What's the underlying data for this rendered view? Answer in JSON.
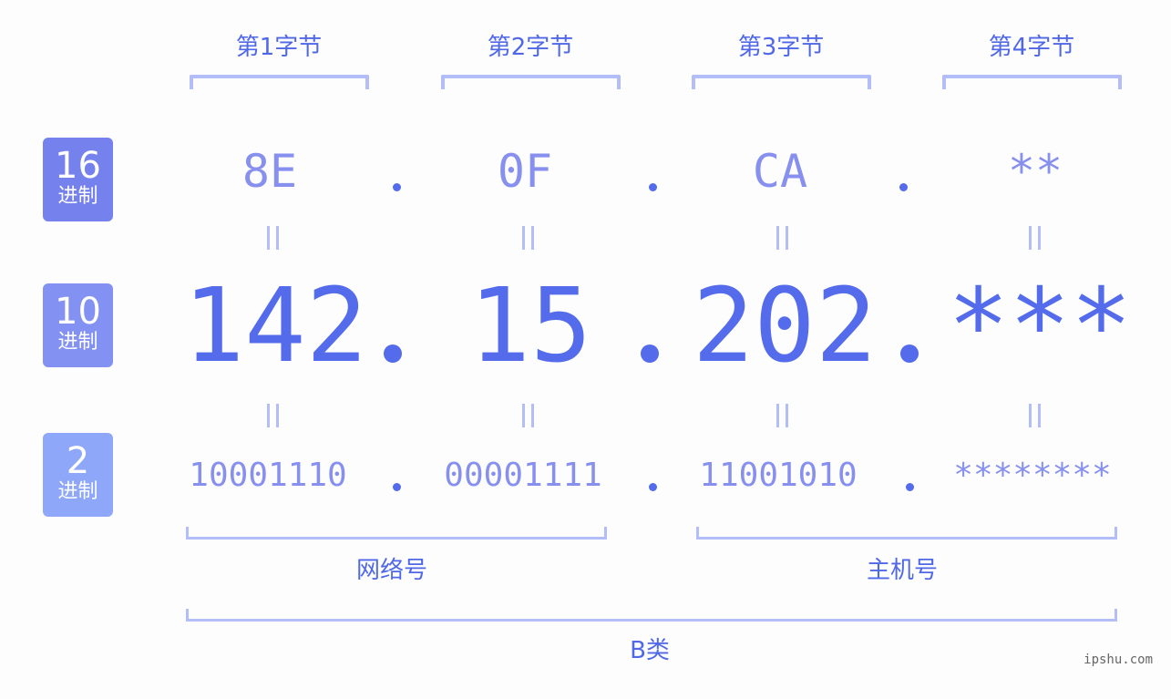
{
  "colors": {
    "accent": "#546cec",
    "label_text": "#5068e8",
    "light_text": "#8790ef",
    "bracket": "#b3bdf7",
    "badge_hex": "#7581ec",
    "badge_dec": "#8391f2",
    "badge_bin": "#8ea7f9"
  },
  "byte_headers": [
    "第1字节",
    "第2字节",
    "第3字节",
    "第4字节"
  ],
  "badges": {
    "hex": {
      "number": "16",
      "unit": "进制"
    },
    "dec": {
      "number": "10",
      "unit": "进制"
    },
    "bin": {
      "number": "2",
      "unit": "进制"
    }
  },
  "hex_row": [
    "8E",
    "0F",
    "CA",
    "**"
  ],
  "dec_row": [
    "142",
    "15",
    "202",
    "***"
  ],
  "bin_row": [
    "10001110",
    "00001111",
    "11001010",
    "********"
  ],
  "separator": ".",
  "groups": {
    "network": "网络号",
    "host": "主机号",
    "class": "B类"
  },
  "watermark": "ipshu.com"
}
